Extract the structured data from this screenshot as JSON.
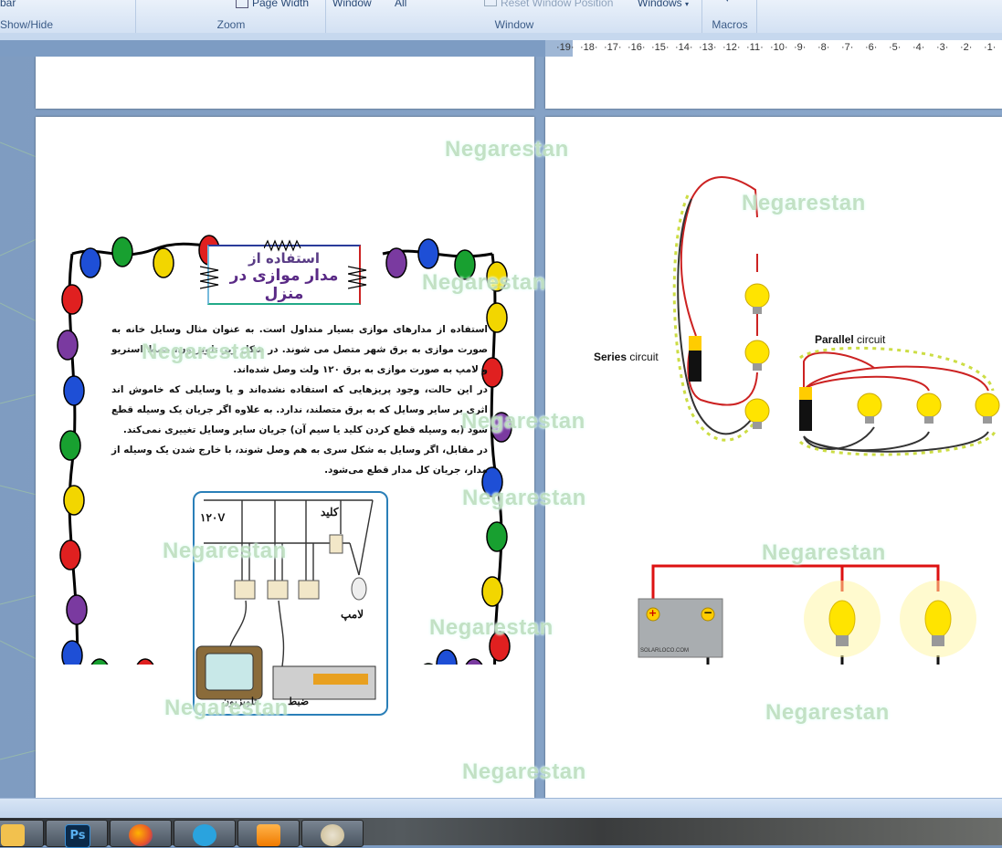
{
  "ribbon": {
    "show_hide_group": "Show/Hide",
    "show_hide_top": "bar",
    "zoom_group": "Zoom",
    "zoom_top": "Page Width",
    "window_group": "Window",
    "window_top_1": "Window",
    "window_top_2": "All",
    "window_top_3": "Reset Window Position",
    "window_top_4": "Windows",
    "macros_group": "Macros"
  },
  "ruler": {
    "ticks": [
      "19",
      "18",
      "17",
      "16",
      "15",
      "14",
      "13",
      "12",
      "11",
      "10",
      "9",
      "8",
      "7",
      "6",
      "5",
      "4",
      "3",
      "2",
      "1"
    ]
  },
  "watermark": "Negarestan",
  "left_page": {
    "title_line1": "استفاده از",
    "title_line2": "مدار موازی در منزل",
    "para1": "استفاده از مدارهای موازی بسیار متداول است. به عنوان مثال وسایل خانه به صورت موازی به برق شهر متصل می شوند. در شکل زیر تلویزیون، ضبط استریو و لامپ به صورت موازی به برق ۱۲۰ ولت وصل شده‌اند.",
    "para2": "در این حالت، وجود پریزهایی که استفاده نشده‌اند و یا وسایلی که خاموش اند اثری بر سایر وسایل که به برق متصلند، ندارد. به علاوه اگر جریان یک وسیله قطع شود (به وسیله قطع کردن کلید یا سیم آن) جریان سایر وسایل تغییری نمی‌کند.",
    "para3": "در مقابل، اگر وسایل به شکل سری به هم وصل شوند، با خارج شدن یک وسیله از مدار، جریان کل مدار قطع می‌شود.",
    "diagram": {
      "voltage": "۱۲۰V",
      "switch_label": "کلید",
      "lamp_label": "لامپ",
      "tv_label": "تلویزیون",
      "stereo_label": "ضبط"
    }
  },
  "right_page": {
    "series_label_bold": "Series",
    "series_label_rest": " circuit",
    "parallel_label_bold": "Parallel",
    "parallel_label_rest": " circuit",
    "battery_brand": "SOLARLOCO.COM",
    "plus": "+",
    "minus": "−"
  },
  "colors": {
    "ribbon_text": "#3b5b87",
    "workspace": "#7f9cc1",
    "wire_red": "#d11",
    "bulb_yellow": "#ffe400"
  }
}
